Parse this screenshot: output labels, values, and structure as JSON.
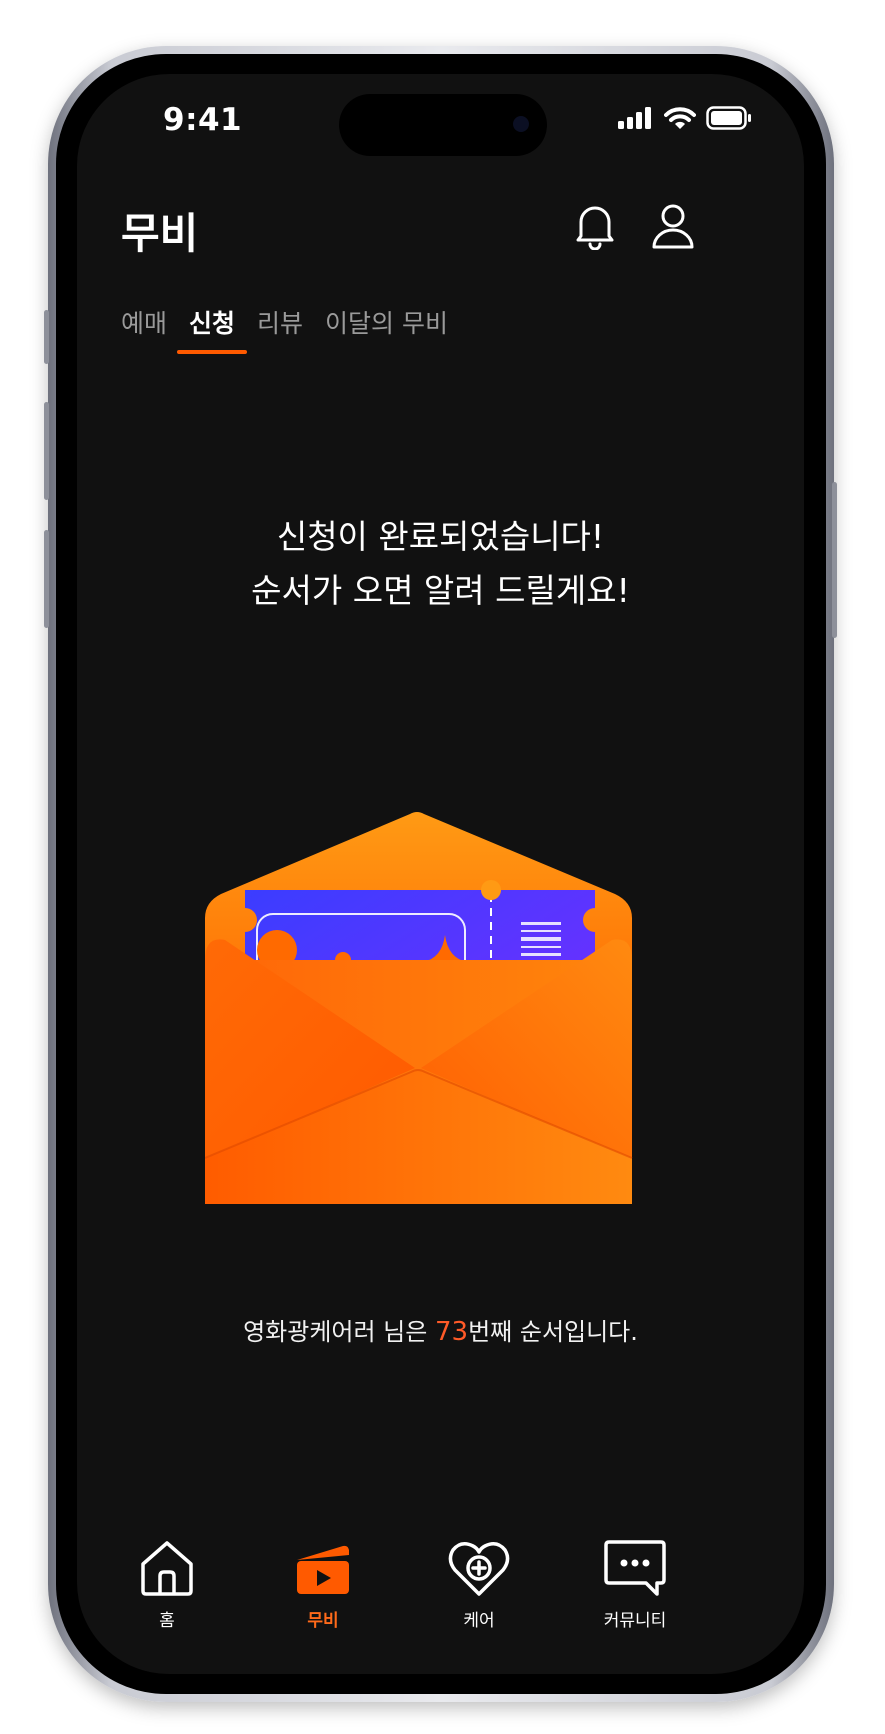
{
  "status_bar": {
    "time": "9:41"
  },
  "header": {
    "title": "무비"
  },
  "tabs": [
    {
      "label": "예매",
      "active": false
    },
    {
      "label": "신청",
      "active": true
    },
    {
      "label": "리뷰",
      "active": false
    },
    {
      "label": "이달의 무비",
      "active": false
    }
  ],
  "message": {
    "line1": "신청이 완료되었습니다!",
    "line2": "순서가 오면 알려 드릴게요!"
  },
  "queue": {
    "prefix": "영화광케어러 님은 ",
    "number": "73",
    "suffix": "번째 순서입니다."
  },
  "bottom_nav": [
    {
      "label": "홈",
      "icon": "home-icon",
      "active": false
    },
    {
      "label": "무비",
      "icon": "movie-clapper-icon",
      "active": true
    },
    {
      "label": "케어",
      "icon": "heart-plus-icon",
      "active": false
    },
    {
      "label": "커뮤니티",
      "icon": "chat-bubble-icon",
      "active": false
    }
  ],
  "colors": {
    "accent": "#FF5A00",
    "background": "#111111",
    "highlight_number": "#FF5A28"
  }
}
